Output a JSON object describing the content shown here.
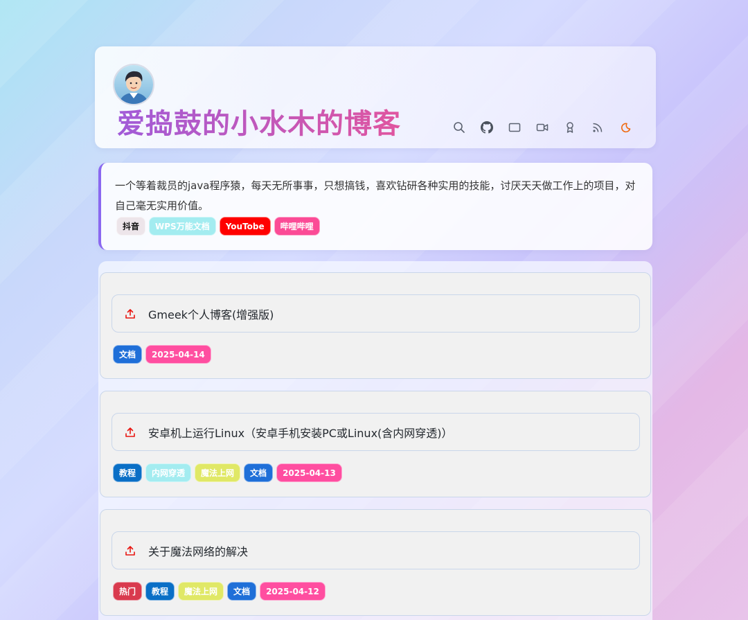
{
  "site": {
    "title": "爱捣鼓的小水木的博客"
  },
  "nav_icons": [
    "search-icon",
    "github-icon",
    "post-icon",
    "video-icon",
    "award-icon",
    "rss-icon",
    "moon-icon"
  ],
  "bio": {
    "text": "一个等着裁员的java程序猿，每天无所事事，只想搞钱，喜欢钻研各种实用的技能，讨厌天天做工作上的项目，对自己毫无实用价值。",
    "tags": [
      {
        "label": "抖音",
        "color": "#ede5ea",
        "text_color": "#111111"
      },
      {
        "label": "WPS万能文档",
        "color": "#a3ecf0",
        "text_color": "#ffffff"
      },
      {
        "label": "YouTobe",
        "color": "#ff0000",
        "text_color": "#ffffff"
      },
      {
        "label": "哔哩哔哩",
        "color": "#fb4b96",
        "text_color": "#ffffff"
      }
    ]
  },
  "posts": [
    {
      "title": "Gmeek个人博客(增强版)",
      "tags": [
        {
          "label": "文档",
          "color": "#1f6fd8"
        },
        {
          "label": "2025-04-14",
          "color": "#ff4ea0"
        }
      ]
    },
    {
      "title": "安卓机上运行Linux（安卓手机安装PC或Linux(含内网穿透)）",
      "tags": [
        {
          "label": "教程",
          "color": "#0a6fc6"
        },
        {
          "label": "内网穿透",
          "color": "#a3ecf0"
        },
        {
          "label": "魔法上网",
          "color": "#e0e866"
        },
        {
          "label": "文档",
          "color": "#1f6fd8"
        },
        {
          "label": "2025-04-13",
          "color": "#ff4ea0"
        }
      ]
    },
    {
      "title": "关于魔法网络的解决",
      "tags": [
        {
          "label": "热门",
          "color": "#d93a4e"
        },
        {
          "label": "教程",
          "color": "#0a6fc6"
        },
        {
          "label": "魔法上网",
          "color": "#e0e866"
        },
        {
          "label": "文档",
          "color": "#1f6fd8"
        },
        {
          "label": "2025-04-12",
          "color": "#ff4ea0"
        }
      ]
    }
  ]
}
